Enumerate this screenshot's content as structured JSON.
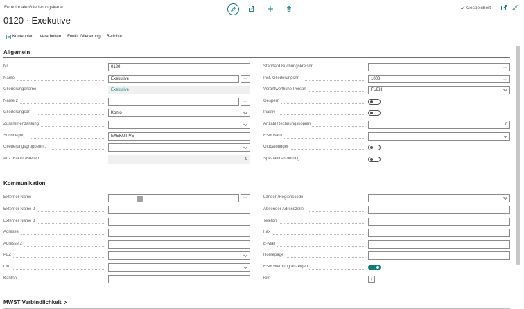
{
  "header": {
    "breadcrumb": "Funktionale Gliederungskarte",
    "title": "0120 · Exekutive",
    "saved_status": "Gespeichert"
  },
  "icons": {
    "edit": "pencil-icon",
    "share": "share-icon",
    "new": "plus-icon",
    "delete": "trash-icon",
    "open_new_window": "open-in-new-window-icon",
    "collapse": "collapse-icon"
  },
  "actions": {
    "kontenplan": "Kontenplan",
    "verarbeiten": "Verarbeiten",
    "funkt_gliederung": "Funkt. Gliederung",
    "berichte": "Berichte"
  },
  "sections": {
    "allgemein": "Allgemein",
    "kommunikation": "Kommunikation",
    "mwst": "MWST Verbindlichkeit"
  },
  "allgemein_left": [
    {
      "label": "Nr.",
      "value": "0120"
    },
    {
      "label": "Name",
      "value": "Exekutive"
    },
    {
      "label": "Gliederungsname",
      "value": "Exekutive"
    },
    {
      "label": "Name 2",
      "value": ""
    },
    {
      "label": "Gliederungsart",
      "value": "Konto"
    },
    {
      "label": "Zusammenzählung",
      "value": ""
    },
    {
      "label": "Suchbegriff",
      "value": "EXEKUTIVE"
    },
    {
      "label": "Gliederungsgruppennr.",
      "value": ""
    },
    {
      "label": "Anz. Fakturastellen",
      "value": "0"
    }
  ],
  "allgemein_right": [
    {
      "label": "Standard Buchungskreisnr.",
      "value": ""
    },
    {
      "label": "Inst. Gliederungsnr.",
      "value": "1000"
    },
    {
      "label": "Verantwortliche Person",
      "value": "FUEH"
    },
    {
      "label": "Gesperrt",
      "toggle": false
    },
    {
      "label": "Inaktiv",
      "toggle": false
    },
    {
      "label": "Anzahl Rechnungskopien",
      "value": "0"
    },
    {
      "label": "ESR Bank",
      "value": ""
    },
    {
      "label": "Globalbudget",
      "toggle": false
    },
    {
      "label": "Spezialfinanzierung",
      "toggle": false
    }
  ],
  "kommunikation_left": [
    {
      "label": "Externer Name",
      "value": ""
    },
    {
      "label": "Externer Name 2",
      "value": ""
    },
    {
      "label": "Externer Name 3",
      "value": ""
    },
    {
      "label": "Adresse",
      "value": ""
    },
    {
      "label": "Adresse 2",
      "value": ""
    },
    {
      "label": "PLZ",
      "value": ""
    },
    {
      "label": "Ort",
      "value": ""
    },
    {
      "label": "Kanton",
      "value": ""
    }
  ],
  "kommunikation_right": [
    {
      "label": "Länder-/Regionscode",
      "value": ""
    },
    {
      "label": "Absender Adresszeile",
      "value": ""
    },
    {
      "label": "Telefon",
      "value": ""
    },
    {
      "label": "Fax",
      "value": ""
    },
    {
      "label": "E-Mail",
      "value": ""
    },
    {
      "label": "Homepage",
      "value": ""
    },
    {
      "label": "ESR Werbung anzeigen",
      "toggle": true
    },
    {
      "label": "Bild",
      "value": "+"
    }
  ],
  "colors": {
    "accent": "#0f7b7b",
    "text": "#212121",
    "label": "#5a5a5a",
    "readonly_bg": "#f0f0f0"
  }
}
